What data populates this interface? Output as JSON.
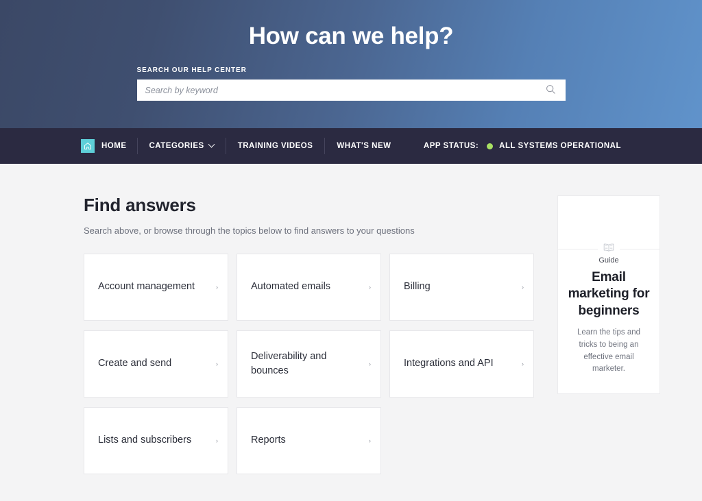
{
  "hero": {
    "title": "How can we help?",
    "search_label": "SEARCH OUR HELP CENTER",
    "search_value": "",
    "search_placeholder": "Search by keyword",
    "search_icon": "search-icon",
    "gradient_from": "#3b4866",
    "gradient_to": "#6093cb"
  },
  "nav": {
    "background": "#2b2a41",
    "home_icon": "home-icon",
    "home_icon_bg": "#5ecfd8",
    "items": [
      {
        "label": "HOME",
        "has_caret": false
      },
      {
        "label": "CATEGORIES",
        "has_caret": true
      },
      {
        "label": "TRAINING VIDEOS",
        "has_caret": false
      },
      {
        "label": "WHAT'S NEW",
        "has_caret": false
      }
    ],
    "status_label": "APP STATUS:",
    "status_value": "ALL SYSTEMS OPERATIONAL",
    "status_color": "#a8e063"
  },
  "main": {
    "title": "Find answers",
    "subtitle": "Search above, or browse through the topics below to find answers to your questions",
    "arrow_glyph": "›",
    "topics": [
      {
        "label": "Account management"
      },
      {
        "label": "Automated emails"
      },
      {
        "label": "Billing"
      },
      {
        "label": "Create and send"
      },
      {
        "label": "Deliverability and bounces"
      },
      {
        "label": "Integrations and API"
      },
      {
        "label": "Lists and subscribers"
      },
      {
        "label": "Reports"
      }
    ]
  },
  "guide": {
    "icon": "open-book-icon",
    "kicker": "Guide",
    "title": "Email marketing for beginners",
    "description": "Learn the tips and tricks to being an effective email marketer."
  }
}
